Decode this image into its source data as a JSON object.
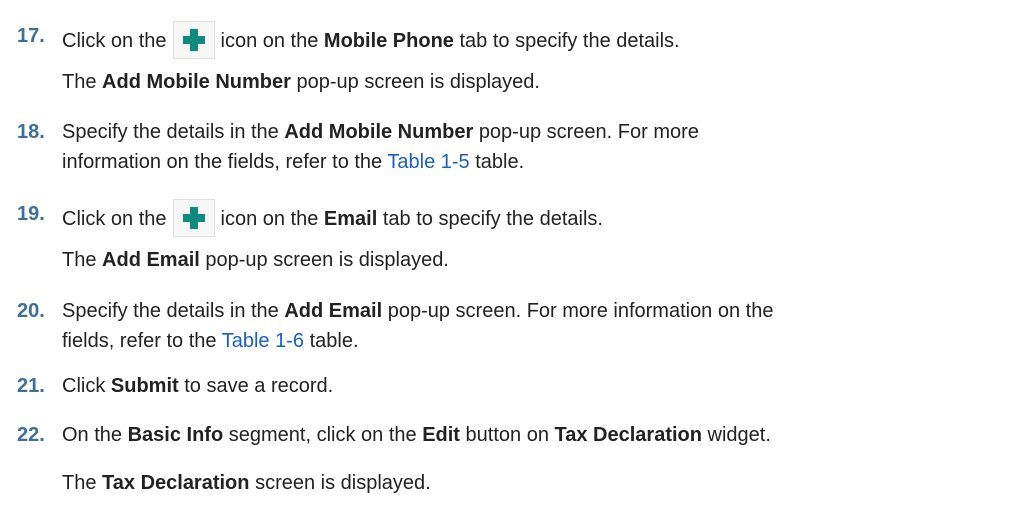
{
  "steps": [
    {
      "num": "17.",
      "t1": "Click on the",
      "t2": "icon on the",
      "b1": "Mobile Phone",
      "t3": "tab to specify the details.",
      "sub_t1": "The",
      "sub_b1": "Add Mobile Number",
      "sub_t2": "pop-up screen is displayed."
    },
    {
      "num": "18.",
      "t1": "Specify the details in the",
      "b1": "Add Mobile Number",
      "t2": "pop-up screen. For more",
      "t3": "information on the fields, refer to the",
      "link": "Table 1-5",
      "t4": "table."
    },
    {
      "num": "19.",
      "t1": "Click on the",
      "t2": "icon on the",
      "b1": "Email",
      "t3": "tab to specify the details.",
      "sub_t1": "The",
      "sub_b1": "Add Email",
      "sub_t2": "pop-up screen is displayed."
    },
    {
      "num": "20.",
      "t1": "Specify the details in the",
      "b1": "Add Email",
      "t2": "pop-up screen. For more information on the",
      "t3": "fields, refer to the",
      "link": "Table 1-6",
      "t4": "table."
    },
    {
      "num": "21.",
      "t1": "Click",
      "b1": "Submit",
      "t2": "to save a record."
    },
    {
      "num": "22.",
      "t1": "On the",
      "b1": "Basic Info",
      "t2": "segment, click on the",
      "b2": "Edit",
      "t3": "button on",
      "b3": "Tax Declaration",
      "t4": "widget.",
      "sub_t1": "The",
      "sub_b1": "Tax Declaration",
      "sub_t2": "screen is displayed."
    }
  ],
  "icons": {
    "add": "plus-icon",
    "add_color": "#0f8a7e"
  }
}
